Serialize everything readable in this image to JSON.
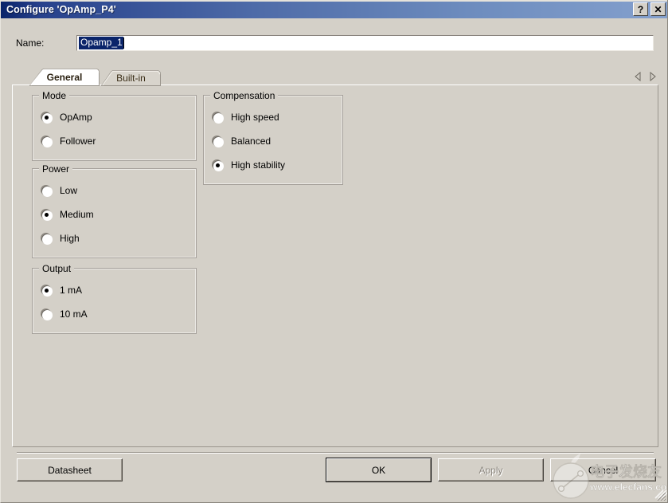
{
  "window": {
    "title": "Configure 'OpAmp_P4'",
    "help_button": "?",
    "close_button": "✕",
    "help_icon_name": "help-icon",
    "close_icon_name": "close-icon",
    "titlebar_gradient_start": "#0a246a",
    "titlebar_gradient_end": "#84a0cd",
    "dialog_background": "#d4d0c8"
  },
  "name_field": {
    "label": "Name:",
    "value": "Opamp_1",
    "placeholder": "",
    "selected": true,
    "selection_color": "#0a246a"
  },
  "tabs": {
    "items": [
      {
        "label": "General",
        "active": true
      },
      {
        "label": "Built-in",
        "active": false
      }
    ],
    "scroll_left_icon": "triangle-left-icon",
    "scroll_right_icon": "triangle-right-icon"
  },
  "groups": [
    {
      "title": "Mode",
      "options": [
        {
          "label": "OpAmp",
          "selected": true
        },
        {
          "label": "Follower",
          "selected": false
        }
      ]
    },
    {
      "title": "Power",
      "options": [
        {
          "label": "Low",
          "selected": false
        },
        {
          "label": "Medium",
          "selected": true
        },
        {
          "label": "High",
          "selected": false
        }
      ]
    },
    {
      "title": "Output",
      "options": [
        {
          "label": "1 mA",
          "selected": true
        },
        {
          "label": "10 mA",
          "selected": false
        }
      ]
    },
    {
      "title": "Compensation",
      "options": [
        {
          "label": "High speed",
          "selected": false
        },
        {
          "label": "Balanced",
          "selected": false
        },
        {
          "label": "High stability",
          "selected": true
        }
      ]
    }
  ],
  "footer": {
    "datasheet": "Datasheet",
    "ok": "OK",
    "apply": "Apply",
    "cancel": "Cancel",
    "apply_disabled": true,
    "ok_is_default": true
  },
  "watermark": {
    "chinese_text": "电子发烧友",
    "url_text": "www.elecfans.com",
    "logo_icon": "elecfans-circuit-logo-icon"
  }
}
